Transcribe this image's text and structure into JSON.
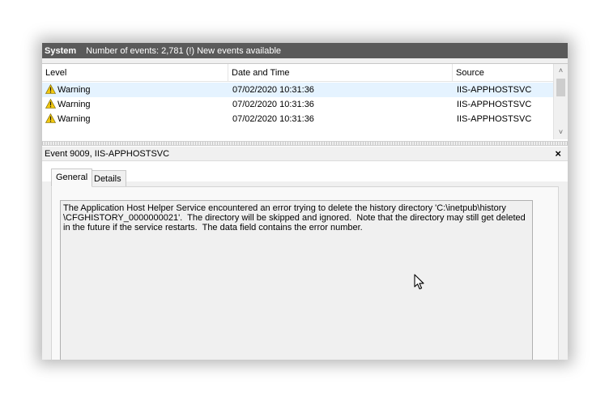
{
  "titlebar": {
    "log_name": "System",
    "summary": "Number of events: 2,781 (!) New events available"
  },
  "list": {
    "columns": [
      "Level",
      "Date and Time",
      "Source"
    ],
    "rows": [
      {
        "level": "Warning",
        "datetime": "07/02/2020 10:31:36",
        "source": "IIS-APPHOSTSVC"
      },
      {
        "level": "Warning",
        "datetime": "07/02/2020 10:31:36",
        "source": "IIS-APPHOSTSVC"
      },
      {
        "level": "Warning",
        "datetime": "07/02/2020 10:31:36",
        "source": "IIS-APPHOSTSVC"
      }
    ]
  },
  "detail": {
    "header": "Event 9009, IIS-APPHOSTSVC",
    "close_glyph": "×",
    "tabs": [
      "General",
      "Details"
    ],
    "active_tab": "General",
    "description": "The Application Host Helper Service encountered an error trying to delete the history directory 'C:\\inetpub\\history\n\\CFGHISTORY_0000000021'.  The directory will be skipped and ignored.  Note that the directory may still get deleted\nin the future if the service restarts.  The data field contains the error number."
  },
  "icons": {
    "warning": "warning-triangle-icon",
    "scroll_up": "chevron-up-icon",
    "scroll_down": "chevron-down-icon",
    "scroll_left": "chevron-left-icon",
    "scroll_right": "chevron-right-icon",
    "cursor": "mouse-pointer-icon"
  },
  "colors": {
    "titlebar_bg": "#5a5a5a",
    "selected_row": "#e5f3ff",
    "warning_yellow": "#f2c80f"
  }
}
